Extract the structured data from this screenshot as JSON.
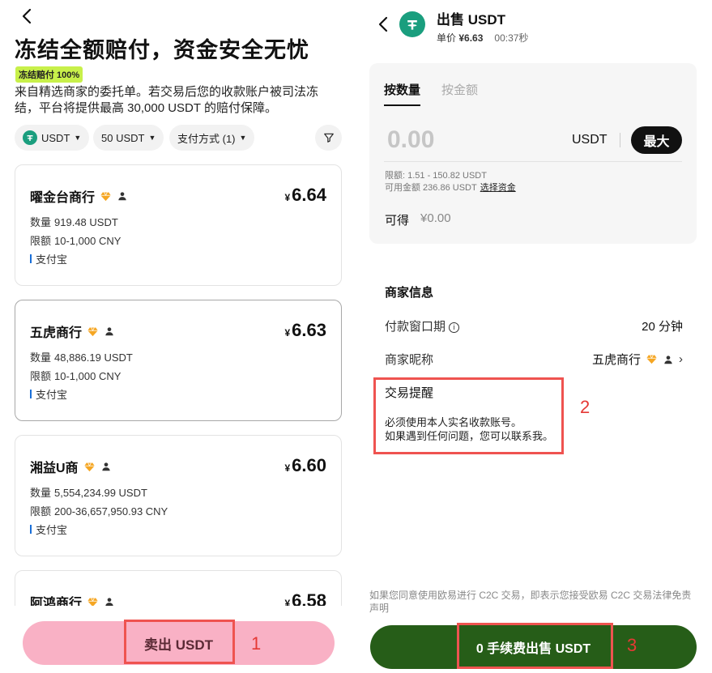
{
  "left": {
    "hero_title": "冻结全额赔付，资金安全无忧",
    "badge": "冻结赔付 100%",
    "description": "来自精选商家的委托单。若交易后您的收款账户被司法冻结，平台将提供最高 30,000 USDT 的赔付保障。",
    "filters": {
      "coin": "USDT",
      "amount": "50 USDT",
      "payment": "支付方式 (1)"
    },
    "quantity_label": "数量",
    "limit_label": "限额",
    "currency_symbol": "¥",
    "offers": [
      {
        "merchant": "曜金台商行",
        "price": "6.64",
        "quantity": "919.48 USDT",
        "limit": "10-1,000 CNY",
        "payment": "支付宝"
      },
      {
        "merchant": "五虎商行",
        "price": "6.63",
        "quantity": "48,886.19 USDT",
        "limit": "10-1,000 CNY",
        "payment": "支付宝"
      },
      {
        "merchant": "湘益U商",
        "price": "6.60",
        "quantity": "5,554,234.99 USDT",
        "limit": "200-36,657,950.93 CNY",
        "payment": "支付宝"
      },
      {
        "merchant": "阿鸿商行",
        "price": "6.58",
        "quantity": "",
        "limit": "",
        "payment": ""
      }
    ],
    "sell_button": "卖出 USDT",
    "annotation": "1"
  },
  "right": {
    "title": "出售 USDT",
    "unit_price_label": "单价",
    "unit_price": "¥6.63",
    "timer": "00:37秒",
    "tabs": [
      "按数量",
      "按金额"
    ],
    "amount_value": "0.00",
    "amount_currency": "USDT",
    "max_button": "最大",
    "limit_text": "限额: 1.51 - 150.82 USDT",
    "available_text": "可用金额 236.86 USDT",
    "select_funds": "选择资金",
    "receive_label": "可得",
    "receive_value": "¥0.00",
    "merchant_info_title": "商家信息",
    "payment_window_label": "付款窗口期",
    "payment_window_value": "20 分钟",
    "nickname_label": "商家昵称",
    "nickname_value": "五虎商行",
    "reminder_title": "交易提醒",
    "reminder_line1": "必须使用本人实名收款账号。",
    "reminder_line2": "如果遇到任何问题，您可以联系我。",
    "disclaimer": "如果您同意使用欧易进行 C2C 交易，即表示您接受欧易 C2C 交易法律免责声明",
    "sell_button": "0 手续费出售 USDT",
    "annotation_2": "2",
    "annotation_3": "3"
  },
  "colors": {
    "accent_green": "#265d18",
    "pink_button": "#f9b1c5",
    "badge_green": "#c8f04a",
    "annotation_red": "#ef5350",
    "tether": "#1a9e7e",
    "diamond": "#f5a623"
  }
}
